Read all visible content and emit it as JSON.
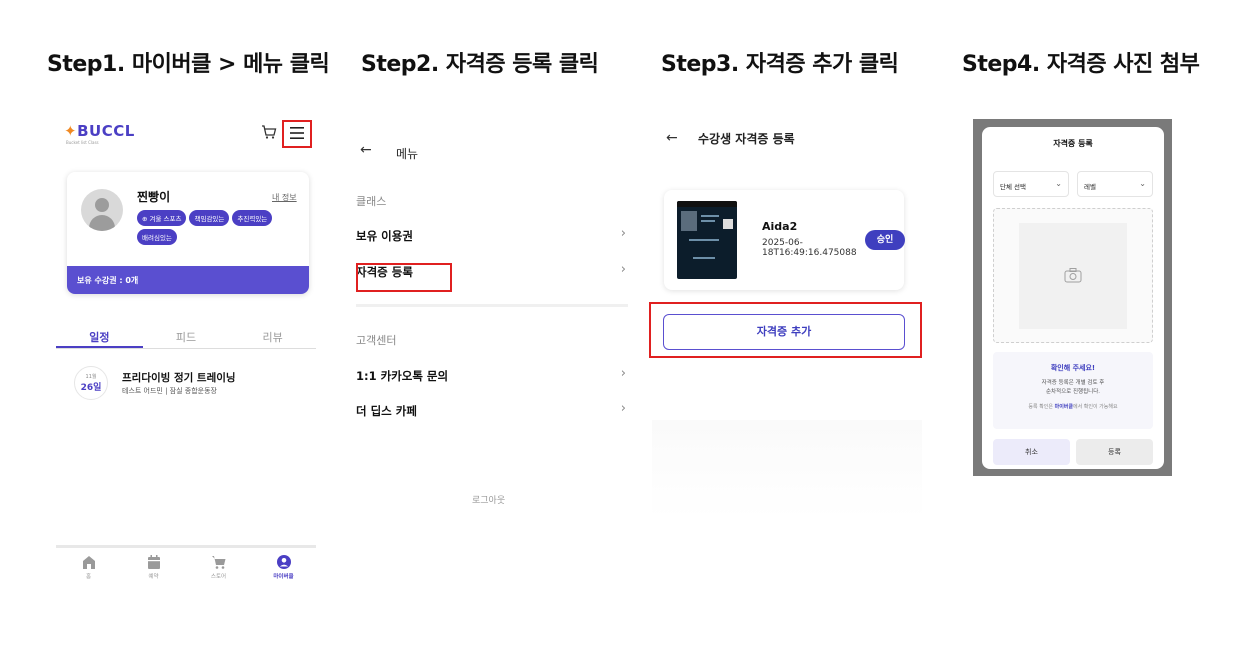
{
  "steps": [
    {
      "title": "Step1. 마이버클 > 메뉴 클릭"
    },
    {
      "title": "Step2. 자격증 등록 클릭"
    },
    {
      "title": "Step3. 자격증 추가 클릭"
    },
    {
      "title": "Step4. 자격증 사진 첨부"
    }
  ],
  "colors": {
    "accent": "#4b3fc4",
    "highlight": "#e02020",
    "logo_orange": "#f08a24"
  },
  "panel1": {
    "logo": "BUCCL",
    "logo_sub": "Bucket list Class",
    "icons": {
      "cart": "cart-icon",
      "menu": "hamburger-menu-icon"
    },
    "profile": {
      "nickname": "찐빵이",
      "my_info_link": "내 정보",
      "tags": [
        "⊕ 겨울 스포츠",
        "책임감있는",
        "추진력있는",
        "배려심있는"
      ],
      "tickets": "보유 수강권 : 0개"
    },
    "tabs": [
      "일정",
      "피드",
      "리뷰"
    ],
    "active_tab": "일정",
    "schedule": {
      "month": "11월",
      "day": "26일",
      "title": "프리다이빙 정기 트레이닝",
      "subtitle": "테스트 어드민 | 잠실 종합운동장"
    },
    "bottom_nav": [
      {
        "label": "홈",
        "icon": "home-icon"
      },
      {
        "label": "예약",
        "icon": "calendar-icon"
      },
      {
        "label": "스토어",
        "icon": "cart-icon"
      },
      {
        "label": "마이버클",
        "icon": "user-icon"
      }
    ],
    "active_nav": "마이버클"
  },
  "panel2": {
    "back": "←",
    "title": "메뉴",
    "sections": [
      {
        "label": "클래스",
        "items": [
          "보유 이용권",
          "자격증 등록"
        ]
      },
      {
        "label": "고객센터",
        "items": [
          "1:1 카카오톡 문의",
          "더 딥스 카페"
        ]
      }
    ],
    "chevron": "›",
    "logout": "로그아웃"
  },
  "panel3": {
    "back": "←",
    "title": "수강생 자격증 등록",
    "cert": {
      "name": "Aida2",
      "date": "2025-06-18T16:49:16.475088",
      "status": "승인"
    },
    "add_button": "자격증 추가"
  },
  "panel4": {
    "modal_title": "자격증 등록",
    "select_org": "단체 선택",
    "select_level": "레벨",
    "camera_icon": "camera-icon",
    "notice_title": "확인해 주세요!",
    "notice_line1": "자격증 등록은 개별 검토 후",
    "notice_line2": "순차적으로 진행됩니다.",
    "notice_foot_pre": "등록 확인은 ",
    "notice_foot_link": "마이버클",
    "notice_foot_post": "에서 확인이 가능해요",
    "cancel": "취소",
    "register": "등록"
  }
}
